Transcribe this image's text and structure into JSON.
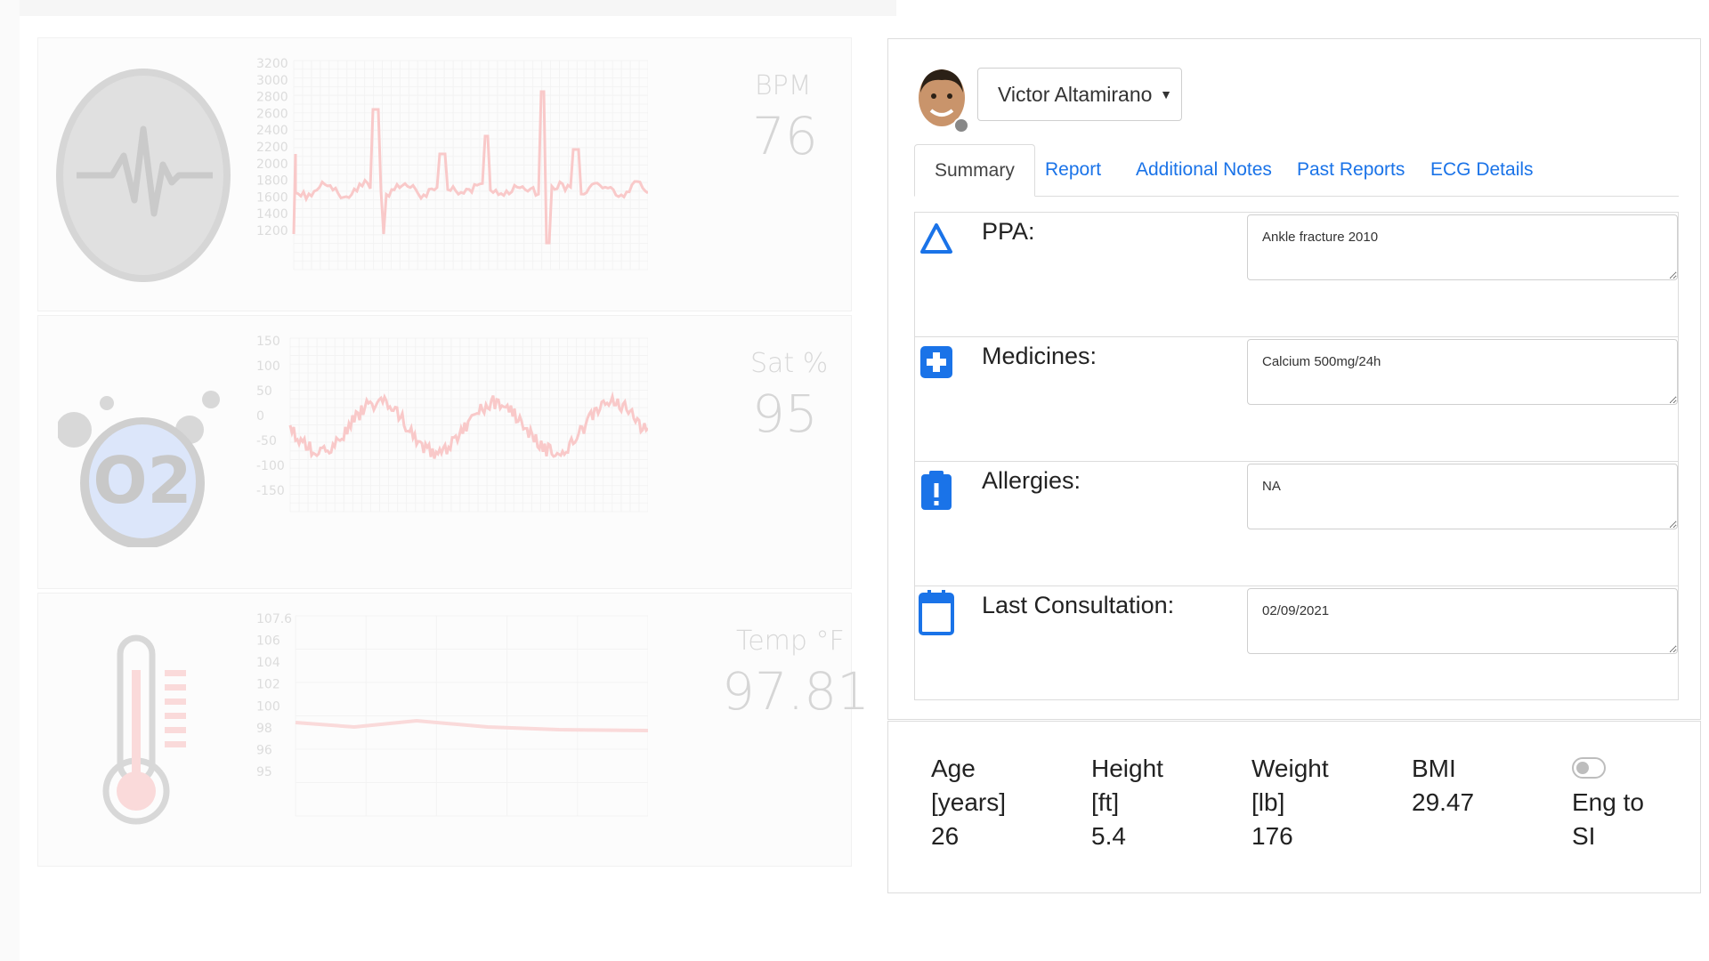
{
  "vitals": {
    "heart": {
      "label": "BPM",
      "value": "76",
      "y_ticks": [
        "3200",
        "3000",
        "2800",
        "2600",
        "2400",
        "2200",
        "2000",
        "1800",
        "1600",
        "1400",
        "1200"
      ]
    },
    "oxygen": {
      "label": "Sat %",
      "value": "95",
      "icon_text": "O2",
      "y_ticks": [
        "150",
        "100",
        "50",
        "0",
        "-50",
        "-100",
        "-150"
      ]
    },
    "temperature": {
      "label": "Temp °F",
      "value": "97.81",
      "y_ticks": [
        "107.6",
        "106",
        "104",
        "102",
        "100",
        "98",
        "96",
        "95"
      ]
    }
  },
  "patient": {
    "name": "Victor Altamirano",
    "status_color": "#888888"
  },
  "tabs": [
    {
      "label": "Summary",
      "active": true
    },
    {
      "label": "Report",
      "active": false
    },
    {
      "label": "Additional Notes",
      "active": false
    },
    {
      "label": "Past Reports",
      "active": false
    },
    {
      "label": "ECG Details",
      "active": false
    }
  ],
  "summary": {
    "ppa": {
      "label": "PPA:",
      "value": "Ankle fracture 2010",
      "icon": "triangle-icon"
    },
    "medicines": {
      "label": "Medicines:",
      "value": "Calcium 500mg/24h",
      "icon": "medical-cross-icon"
    },
    "allergies": {
      "label": "Allergies:",
      "value": "NA",
      "icon": "clipboard-alert-icon"
    },
    "last_consultation": {
      "label": "Last Consultation:",
      "value": "02/09/2021",
      "icon": "calendar-icon"
    }
  },
  "metrics": {
    "age": {
      "label": "Age",
      "unit": "[years]",
      "value": "26"
    },
    "height": {
      "label": "Height",
      "unit": "[ft]",
      "value": "5.4"
    },
    "weight": {
      "label": "Weight",
      "unit": "[lb]",
      "value": "176"
    },
    "bmi": {
      "label": "BMI",
      "value": "29.47"
    },
    "conversion": {
      "line1": "Eng to",
      "line2": "SI",
      "enabled": false
    }
  },
  "colors": {
    "accent": "#1a73e8",
    "faded_trace": "#f9c9c9"
  }
}
